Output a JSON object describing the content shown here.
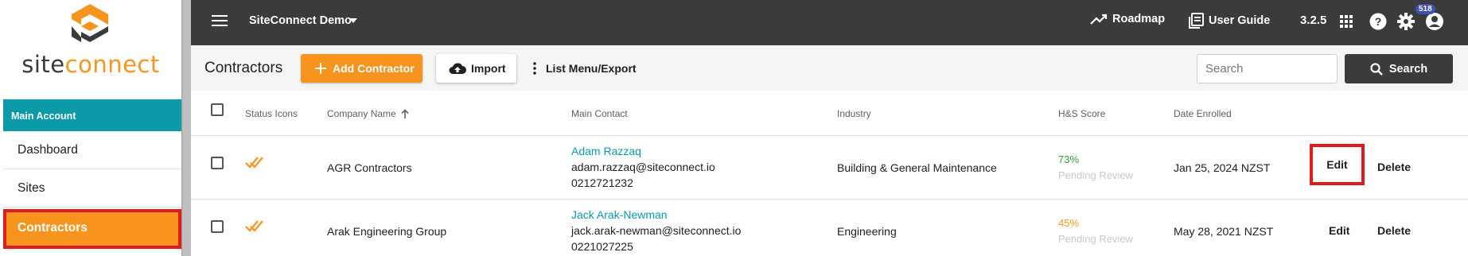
{
  "sidebar": {
    "logo": {
      "text_site": "site",
      "text_connect": "connect"
    },
    "section_label": "Main Account",
    "items": [
      {
        "label": "Dashboard"
      },
      {
        "label": "Sites"
      },
      {
        "label": "Contractors"
      }
    ]
  },
  "topbar": {
    "project_name": "SiteConnect Demo",
    "roadmap_label": "Roadmap",
    "user_guide_label": "User Guide",
    "version": "3.2.5",
    "notification_count": "518",
    "icons": [
      "menu-icon",
      "chevron-down-icon",
      "trending-up-icon",
      "book-icon",
      "apps-grid-icon",
      "help-icon",
      "gear-icon",
      "account-icon"
    ]
  },
  "toolbar": {
    "title": "Contractors",
    "add_label": "Add Contractor",
    "import_label": "Import",
    "list_menu_label": "List Menu/Export",
    "search_placeholder": "Search",
    "search_button_label": "Search"
  },
  "table": {
    "columns": {
      "status_icons": "Status Icons",
      "company_name": "Company Name",
      "main_contact": "Main Contact",
      "industry": "Industry",
      "hs_score": "H&S Score",
      "date_enrolled": "Date Enrolled"
    },
    "rows": [
      {
        "company": "AGR Contractors",
        "contact_name": "Adam Razzaq",
        "contact_email": "adam.razzaq@siteconnect.io",
        "contact_phone": "0212721232",
        "industry": "Building & General Maintenance",
        "score": "73%",
        "score_status": "Pending Review",
        "date": "Jan 25, 2024 NZST",
        "edit_label": "Edit",
        "delete_label": "Delete"
      },
      {
        "company": "Arak Engineering Group",
        "contact_name": "Jack Arak-Newman",
        "contact_email": "jack.arak-newman@siteconnect.io",
        "contact_phone": "0221027225",
        "industry": "Engineering",
        "score": "45%",
        "score_status": "Pending Review",
        "date": "May 28, 2021 NZST",
        "edit_label": "Edit",
        "delete_label": "Delete"
      }
    ]
  },
  "colors": {
    "accent_orange": "#f7941d",
    "teal": "#0b9aa8",
    "topbar": "#3b3b3b",
    "highlight_red": "#e11b1b",
    "score_good": "#2e9d3a"
  }
}
